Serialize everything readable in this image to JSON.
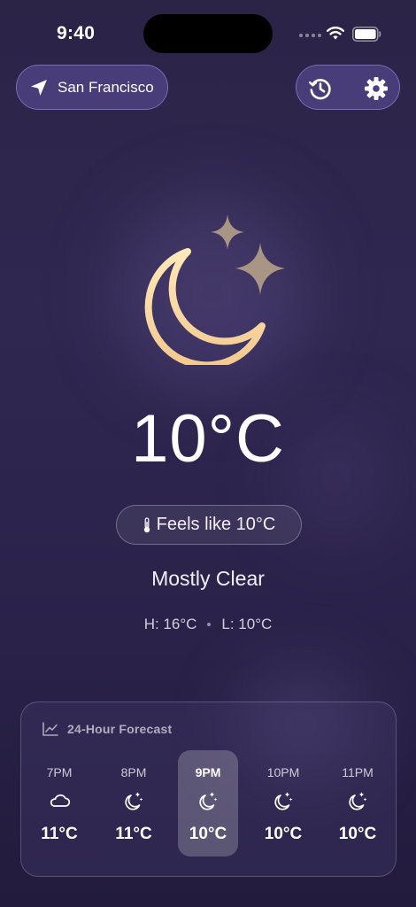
{
  "status_bar": {
    "time": "9:40"
  },
  "header": {
    "location": "San Francisco",
    "location_icon": "location-arrow-icon",
    "history_icon": "history-icon",
    "settings_icon": "gear-icon"
  },
  "current": {
    "icon": "moon-stars-icon",
    "temperature": "10°C",
    "feels_like": "Feels like 10°C",
    "condition": "Mostly Clear",
    "high": "H: 16°C",
    "low": "L: 10°C"
  },
  "forecast": {
    "title": "24-Hour Forecast",
    "hours": [
      {
        "time": "7PM",
        "icon": "cloud-icon",
        "temp": "11°C",
        "selected": false
      },
      {
        "time": "8PM",
        "icon": "moon-stars-icon",
        "temp": "11°C",
        "selected": false
      },
      {
        "time": "9PM",
        "icon": "moon-stars-icon",
        "temp": "10°C",
        "selected": true
      },
      {
        "time": "10PM",
        "icon": "moon-stars-icon",
        "temp": "10°C",
        "selected": false
      },
      {
        "time": "11PM",
        "icon": "moon-stars-icon",
        "temp": "10°C",
        "selected": false
      }
    ]
  },
  "colors": {
    "background": "#2c2447",
    "moon_gradient_top": "#ffe3ad",
    "moon_gradient_bottom": "#f2c890",
    "stars": "#a89583",
    "pill_fill": "#5f50a0",
    "pill_border": "#aa96e6"
  }
}
